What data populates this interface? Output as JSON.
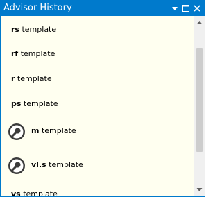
{
  "window": {
    "title": "Advisor History",
    "accent_color": "#007acc",
    "background_color": "#fffff0",
    "controls": [
      "dropdown-icon",
      "maximize-icon",
      "close-icon"
    ]
  },
  "items": [
    {
      "prefix": "rs",
      "suffix": " template",
      "icon": null
    },
    {
      "prefix": "rf",
      "suffix": " template",
      "icon": null
    },
    {
      "prefix": "r",
      "suffix": " template",
      "icon": null
    },
    {
      "prefix": "ps",
      "suffix": " template",
      "icon": null
    },
    {
      "prefix": "m",
      "suffix": " template",
      "icon": "magnifier-icon"
    },
    {
      "prefix": "vl.s",
      "suffix": " template",
      "icon": "magnifier-icon"
    },
    {
      "prefix": "vs",
      "suffix": " template",
      "icon": null
    }
  ],
  "scrollbar": {
    "position_fraction": 0.0
  }
}
